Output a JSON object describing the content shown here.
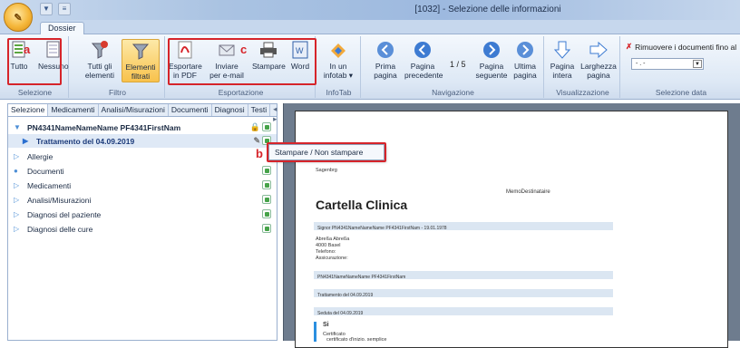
{
  "window": {
    "title": "[1032] - Selezione delle informazioni"
  },
  "ribbon_tab": "Dossier",
  "groups": {
    "selezione": {
      "label": "Selezione",
      "buttons": [
        "Tutto",
        "Nessuno"
      ]
    },
    "filtro": {
      "label": "Filtro",
      "tutti": "Tutti gli elementi",
      "filtrati": "Elementi filtrati"
    },
    "esportazione": {
      "label": "Esportazione",
      "pdf": "Esportare in PDF",
      "email": "Inviare per e-mail",
      "stampare": "Stampare",
      "word": "Word"
    },
    "infotab": {
      "label": "InfoTab",
      "btn": "In un infotab ▾"
    },
    "navigazione": {
      "label": "Navigazione",
      "prima": "Prima pagina",
      "precedente": "Pagina precedente",
      "page_indicator": "1 / 5",
      "seguente": "Pagina seguente",
      "ultima": "Ultima pagina"
    },
    "visualizzazione": {
      "label": "Visualizzazione",
      "intera": "Pagina intera",
      "larghezza": "Larghezza pagina"
    },
    "selezione_data": {
      "label": "Selezione data",
      "rimuovere": "Rimuovere i documenti fino al",
      "date_value": "- . -"
    }
  },
  "markers": {
    "a": "a",
    "b": "b",
    "c": "c"
  },
  "panel_tabs": [
    "Selezione",
    "Medicamenti",
    "Analisi/Misurazioni",
    "Documenti",
    "Diagnosi",
    "Testi"
  ],
  "tree": {
    "patient": "PN4341NameNameName PF4341FirstNam",
    "trattamento": "Trattamento del 04.09.2019",
    "items": [
      "Allergie",
      "Documenti",
      "Medicamenti",
      "Analisi/Misurazioni",
      "Diagnosi del paziente",
      "Diagnosi delle cure"
    ]
  },
  "popup": {
    "label": "Stampare / Non stampare"
  },
  "document": {
    "title": "Cartella Clinica",
    "place": "Sagenbrg",
    "recipient": "MemoDestinataire",
    "bar1": "Signor PN4341NameNameName PF4341FirstNam - 19.01.1978",
    "address_lines": [
      "Abreßa Abreßa",
      "4000 Basel",
      "Telefono:",
      "Assicurazione:"
    ],
    "bar2": "PN4341NameNameName PF4341FirstNam",
    "bar3": "Trattamento del 04.09.2019",
    "bar4": "Seduta del 04.09.2019",
    "section": "Si",
    "cert_lines": [
      "Certificato",
      "certificato d'inizio. semplice"
    ]
  },
  "colors": {
    "highlight": "#d6242a",
    "ribbon_active": "#f8c24c"
  }
}
